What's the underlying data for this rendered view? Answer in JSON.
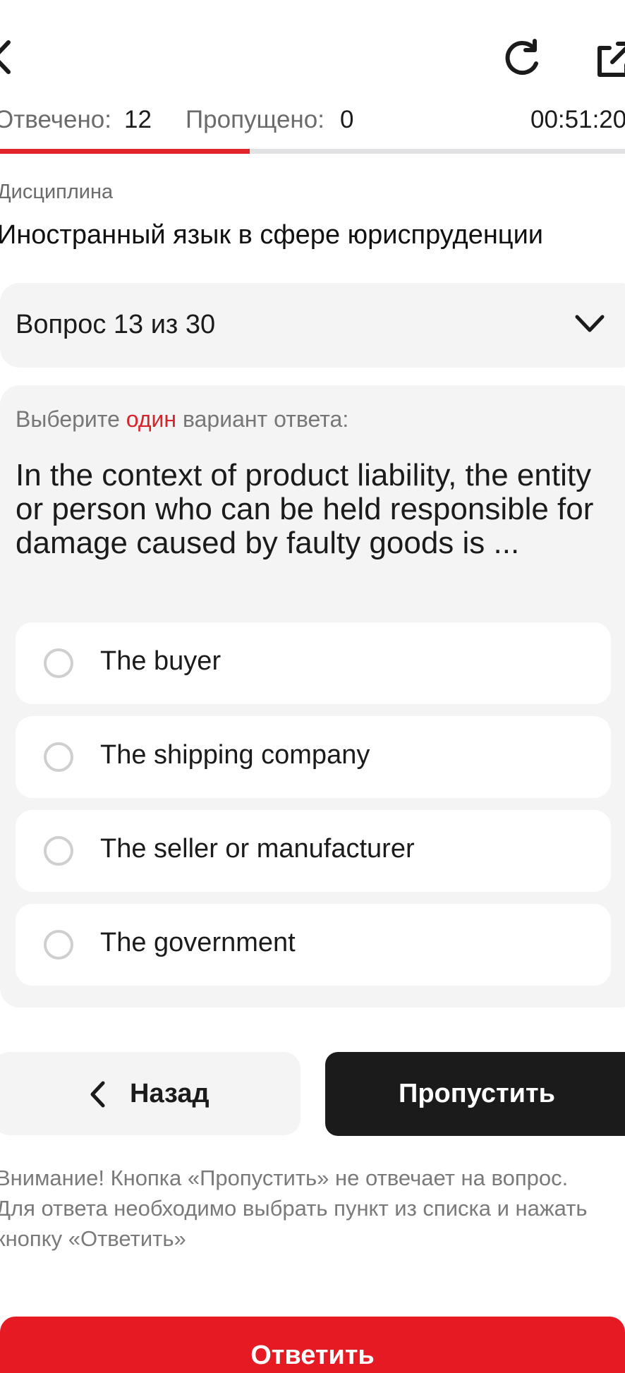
{
  "header": {
    "answered_label": "Отвечено:",
    "answered_value": "12",
    "skipped_label": "Пропущено:",
    "skipped_value": "0",
    "timer": "00:51:20",
    "progress_fraction": 0.4
  },
  "discipline": {
    "label": "Дисциплина",
    "name": "Иностранный язык в сфере юриспруденции"
  },
  "question_selector": {
    "label": "Вопрос 13 из 30"
  },
  "question": {
    "instruction_prefix": "Выберите",
    "instruction_accent": "один",
    "instruction_suffix": "вариант ответа:",
    "text": "In the context of product liability, the entity or person who can be held responsible for damage caused by faulty goods is ...",
    "options": [
      {
        "label": "The buyer"
      },
      {
        "label": "The shipping company"
      },
      {
        "label": "The seller or manufacturer"
      },
      {
        "label": "The government"
      }
    ]
  },
  "buttons": {
    "back": "Назад",
    "skip": "Пропустить",
    "answer": "Ответить"
  },
  "notice": "Внимание! Кнопка «Пропустить» не отвечает на вопрос. Для ответа необходимо выбрать пункт из списка и нажать кнопку «Ответить»",
  "colors": {
    "accent": "#e3242b",
    "dark_button": "#1b1b1b",
    "card_bg": "#f4f4f4"
  }
}
